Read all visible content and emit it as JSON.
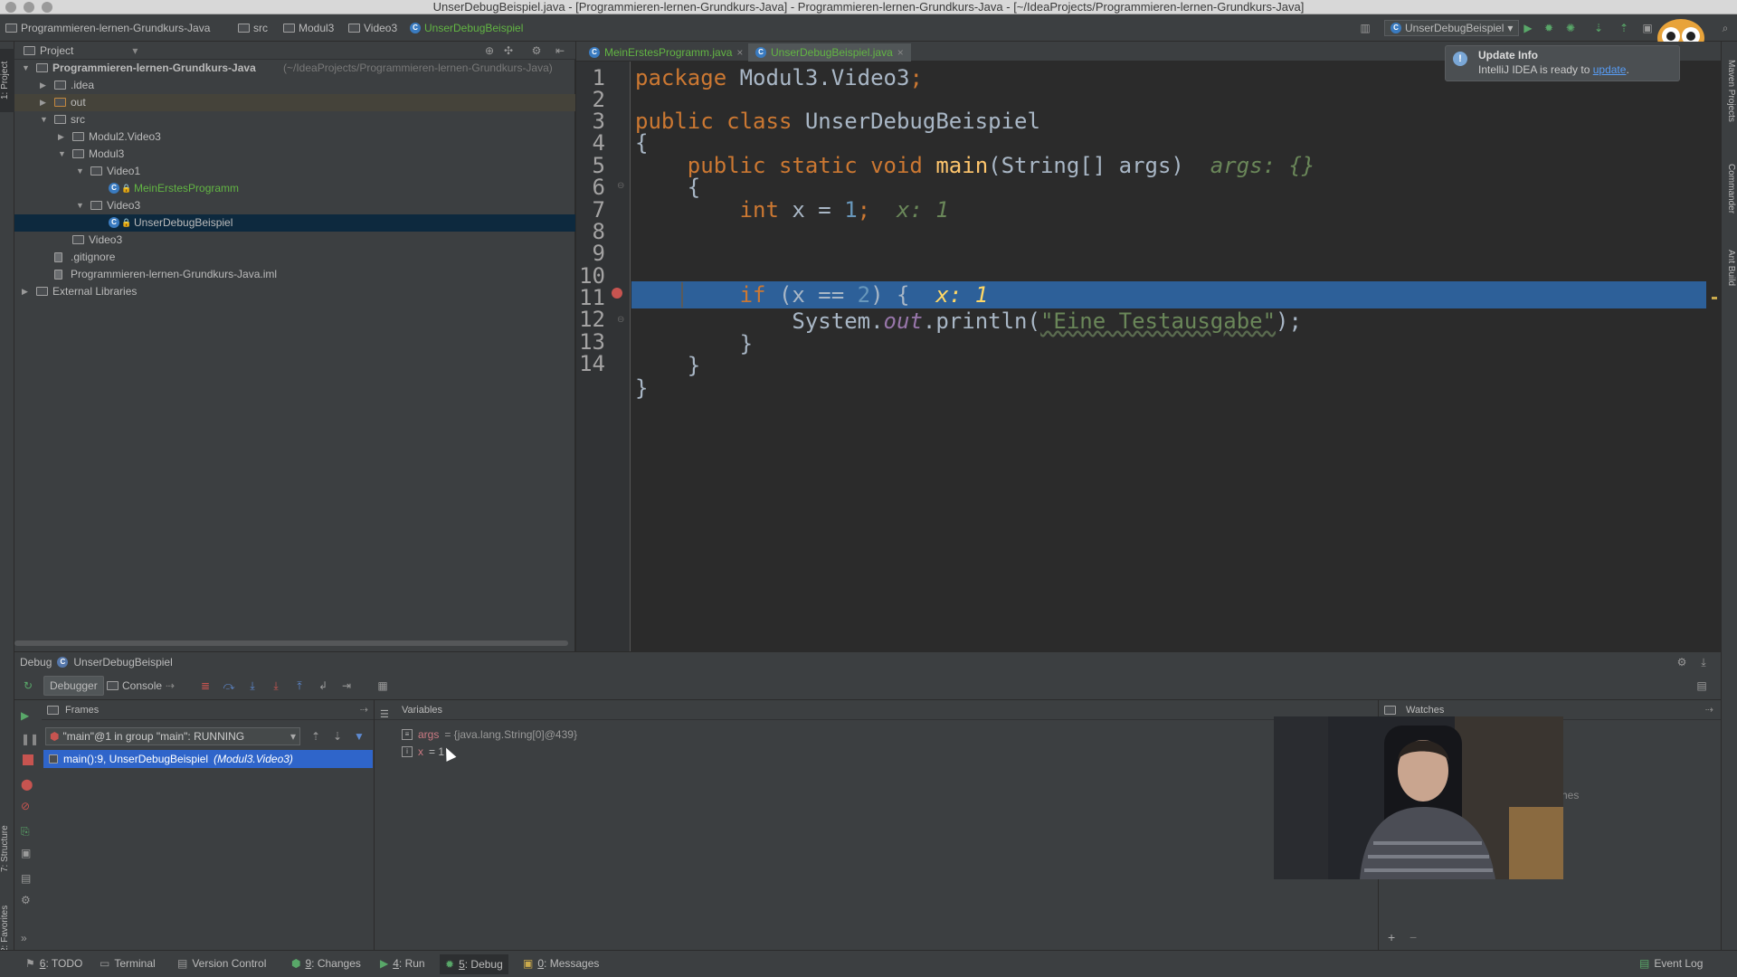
{
  "window": {
    "title": "UnserDebugBeispiel.java - [Programmieren-lernen-Grundkurs-Java] - Programmieren-lernen-Grundkurs-Java - [~/IdeaProjects/Programmieren-lernen-Grundkurs-Java]"
  },
  "breadcrumb": {
    "items": [
      "Programmieren-lernen-Grundkurs-Java",
      "src",
      "Modul3",
      "Video3",
      "UnserDebugBeispiel"
    ]
  },
  "run_config": {
    "label": "UnserDebugBeispiel"
  },
  "left_tool_tabs": [
    "1: Project",
    "7: Structure",
    "2: Favorites"
  ],
  "right_tool_tabs": [
    "Maven Projects",
    "Commander",
    "Ant Build"
  ],
  "project_panel": {
    "title": "Project",
    "tree": [
      {
        "label": "Programmieren-lernen-Grundkurs-Java",
        "suffix": "(~/IdeaProjects/Programmieren-lernen-Grundkurs-Java)",
        "depth": 0,
        "expanded": true,
        "icon": "module-icon"
      },
      {
        "label": ".idea",
        "depth": 1,
        "expanded": false,
        "icon": "folder-icon"
      },
      {
        "label": "out",
        "depth": 1,
        "expanded": false,
        "icon": "folder-icon"
      },
      {
        "label": "src",
        "depth": 1,
        "expanded": true,
        "icon": "folder-icon"
      },
      {
        "label": "Modul2.Video3",
        "depth": 2,
        "expanded": false,
        "icon": "folder-icon"
      },
      {
        "label": "Modul3",
        "depth": 2,
        "expanded": true,
        "icon": "folder-icon"
      },
      {
        "label": "Video1",
        "depth": 3,
        "expanded": true,
        "icon": "folder-icon"
      },
      {
        "label": "MeinErstesProgramm",
        "depth": 4,
        "icon": "class-icon"
      },
      {
        "label": "Video3",
        "depth": 3,
        "expanded": true,
        "icon": "folder-icon"
      },
      {
        "label": "UnserDebugBeispiel",
        "depth": 4,
        "icon": "class-icon",
        "selected": true
      },
      {
        "label": "Video3",
        "depth": 2,
        "icon": "folder-icon"
      },
      {
        "label": ".gitignore",
        "depth": 1,
        "icon": "file-icon"
      },
      {
        "label": "Programmieren-lernen-Grundkurs-Java.iml",
        "depth": 1,
        "icon": "file-icon"
      },
      {
        "label": "External Libraries",
        "depth": 0,
        "expanded": false,
        "icon": "library-icon"
      }
    ]
  },
  "editor": {
    "tabs": [
      {
        "label": "MeinErstesProgramm.java",
        "active": false
      },
      {
        "label": "UnserDebugBeispiel.java",
        "active": true
      }
    ],
    "line_numbers": [
      "1",
      "2",
      "3",
      "4",
      "5",
      "6",
      "7",
      "8",
      "9",
      "10",
      "11",
      "12",
      "13",
      "14"
    ],
    "code": {
      "l1_kw": "package",
      "l1_rest": " Modul3.Video3",
      "l1_semi": ";",
      "l3_kw": "public class",
      "l3_name": " UnserDebugBeispiel",
      "l4": "{",
      "l5_kw": "    public static void",
      "l5_fn": " main",
      "l5_rest": "(String[] args)",
      "l5_hint": "  args: {}",
      "l6": "    {",
      "l7_kw": "        int",
      "l7_mid": " x = ",
      "l7_num": "1",
      "l7_semi": ";",
      "l7_hint": "  x: 1",
      "l9_kw": "        if",
      "l9_mid": " (x == ",
      "l9_num": "2",
      "l9_end": ") {",
      "l9_hint": "  x: 1",
      "l10_pre": "            System.",
      "l10_fld": "out",
      "l10_mid": ".println(",
      "l10_str": "\"Eine Testausgabe\"",
      "l10_end": ");",
      "l11": "        }",
      "l12": "    }",
      "l13": "}"
    }
  },
  "notification": {
    "title": "Update Info",
    "text": "IntelliJ IDEA is ready to",
    "link": "update",
    "tail": "."
  },
  "debug": {
    "header_label": "Debug",
    "session": "UnserDebugBeispiel",
    "tabs": {
      "debugger": "Debugger",
      "console": "Console"
    },
    "frames": {
      "title": "Frames",
      "thread": "\"main\"@1 in group \"main\": RUNNING",
      "items": [
        {
          "method": "main():9, UnserDebugBeispiel",
          "location": "(Modul3.Video3)",
          "selected": true
        }
      ]
    },
    "variables": {
      "title": "Variables",
      "items": [
        {
          "name": "args",
          "value": "= {java.lang.String[0]@439}"
        },
        {
          "name": "x",
          "value": "= 1"
        }
      ]
    },
    "watches": {
      "title": "Watches",
      "partial_text": "hes"
    }
  },
  "statusbar": {
    "tabs": [
      {
        "num": "6",
        "label": ": TODO"
      },
      {
        "num": "",
        "label": "Terminal"
      },
      {
        "num": "",
        "label": "Version Control"
      },
      {
        "num": "9",
        "label": ": Changes"
      },
      {
        "num": "4",
        "label": ": Run"
      },
      {
        "num": "5",
        "label": ": Debug"
      },
      {
        "num": "0",
        "label": ": Messages"
      }
    ],
    "event_log": "Event Log"
  },
  "colors": {
    "editor_bg": "#2b2b2b",
    "panel_bg": "#3c3f41",
    "execution_line": "#2d6099",
    "keyword": "#cc7832",
    "string": "#6a8759",
    "number": "#6897bb",
    "selection": "#0d293e"
  }
}
